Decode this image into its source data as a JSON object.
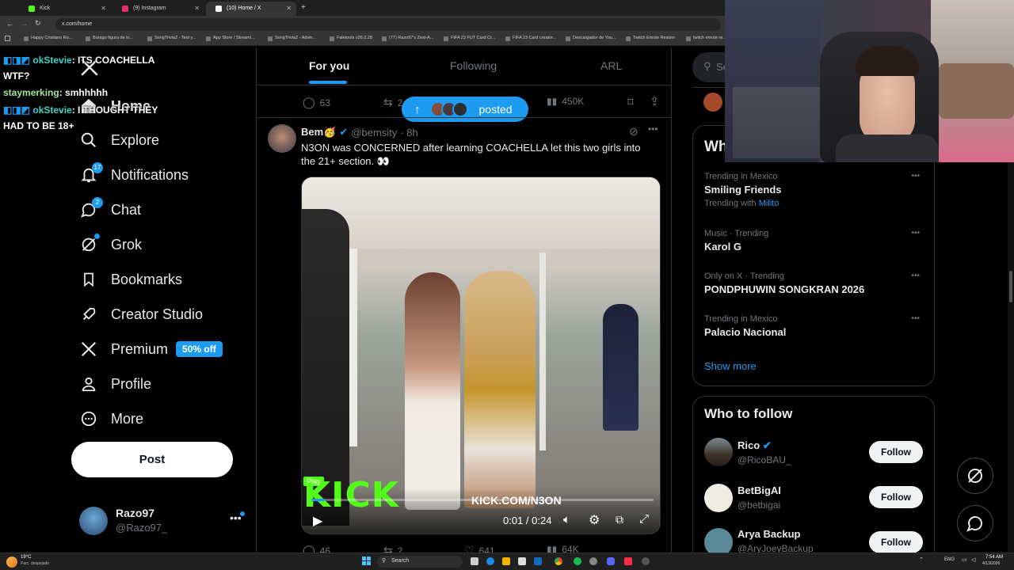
{
  "browser": {
    "tabs": [
      {
        "title": "Kick",
        "color": "#53fc18"
      },
      {
        "title": "(9) Instagram",
        "color": "#e1306c"
      },
      {
        "title": "(10) Home / X",
        "color": "#ffffff"
      }
    ],
    "url": "x.com/home",
    "bookmarks": [
      "Happy Cristiano Ro...",
      "Burago figura de lo...",
      "SongTrivia2 - Test y...",
      "App Store / Streami...",
      "SongTrivia2 - Advin...",
      "Faletools v26.0.28",
      "(77) Razo97's Zest-A...",
      "FIFA 23 FUT Card Cr...",
      "FIFA 23 Card creator...",
      "Descargador de You...",
      "Twitch Emote Resizer",
      "twitch emote re..."
    ]
  },
  "chat": [
    {
      "user": "okStevie",
      "text": ": ITS COACHELLA",
      "cont": "WTF?"
    },
    {
      "user": "staymerking",
      "text": ": smhhhhh"
    },
    {
      "user": "okStevie",
      "text": ": I THOUGHT THEY",
      "cont": "HAD TO BE 18+"
    }
  ],
  "nav": {
    "home": "Home",
    "explore": "Explore",
    "notifications": "Notifications",
    "notifications_count": "17",
    "chat": "Chat",
    "chat_count": "2",
    "grok": "Grok",
    "bookmarks": "Bookmarks",
    "creator_studio": "Creator Studio",
    "premium": "Premium",
    "premium_badge": "50% off",
    "profile": "Profile",
    "more": "More",
    "post": "Post"
  },
  "account": {
    "name": "Razo97",
    "handle": "@Razo97_"
  },
  "feed": {
    "tabs": [
      "For you",
      "Following",
      "ARL"
    ],
    "prev_actions": {
      "replies": "63",
      "retweets": "2",
      "views": "450K"
    },
    "posted_pill": "posted",
    "post": {
      "name": "Bem🥳",
      "handle": "@bemsity",
      "time": "· 8h",
      "text": "N3ON was CONCERNED after learning COACHELLA let this two girls into the 21+ section. 👀",
      "video": {
        "watermark": "KICK",
        "overlay_url": "KICK.COM/N3ON",
        "play_label": "Play",
        "time": "0:01 / 0:24",
        "progress": 0.04
      }
    },
    "next_actions": {
      "replies": "46",
      "retweets": "2",
      "likes": "641",
      "views": "64K"
    }
  },
  "sidebar": {
    "search_placeholder": "Se",
    "trending_title": "Wh",
    "trends": [
      {
        "context": "Trending in Mexico",
        "title": "Smiling Friends",
        "extra_prefix": "Trending with",
        "extra_link": "Milito"
      },
      {
        "context": "Music · Trending",
        "title": "Karol G"
      },
      {
        "context": "Only on X · Trending",
        "title": "PONDPHUWIN SONGKRAN 2026"
      },
      {
        "context": "Trending in Mexico",
        "title": "Palacio Nacional"
      }
    ],
    "show_more": "Show more",
    "who_to_follow_title": "Who to follow",
    "follow_suggestions": [
      {
        "name": "Rico",
        "handle": "@RicoBAU_",
        "verified": true,
        "button": "Follow"
      },
      {
        "name": "BetBigAI",
        "handle": "@betbigai",
        "verified": false,
        "button": "Follow"
      },
      {
        "name": "Arya Backup",
        "handle": "@AryJoeyBackup",
        "verified": false,
        "button": "Follow"
      }
    ]
  },
  "taskbar": {
    "weather_temp": "19°C",
    "weather_desc": "Parc. despejado",
    "search": "Search",
    "lang": "ENG",
    "time": "7:54 AM",
    "date": "4/13/2026"
  },
  "colors": {
    "accent": "#1d9bf0",
    "kick_green": "#53fc18"
  }
}
